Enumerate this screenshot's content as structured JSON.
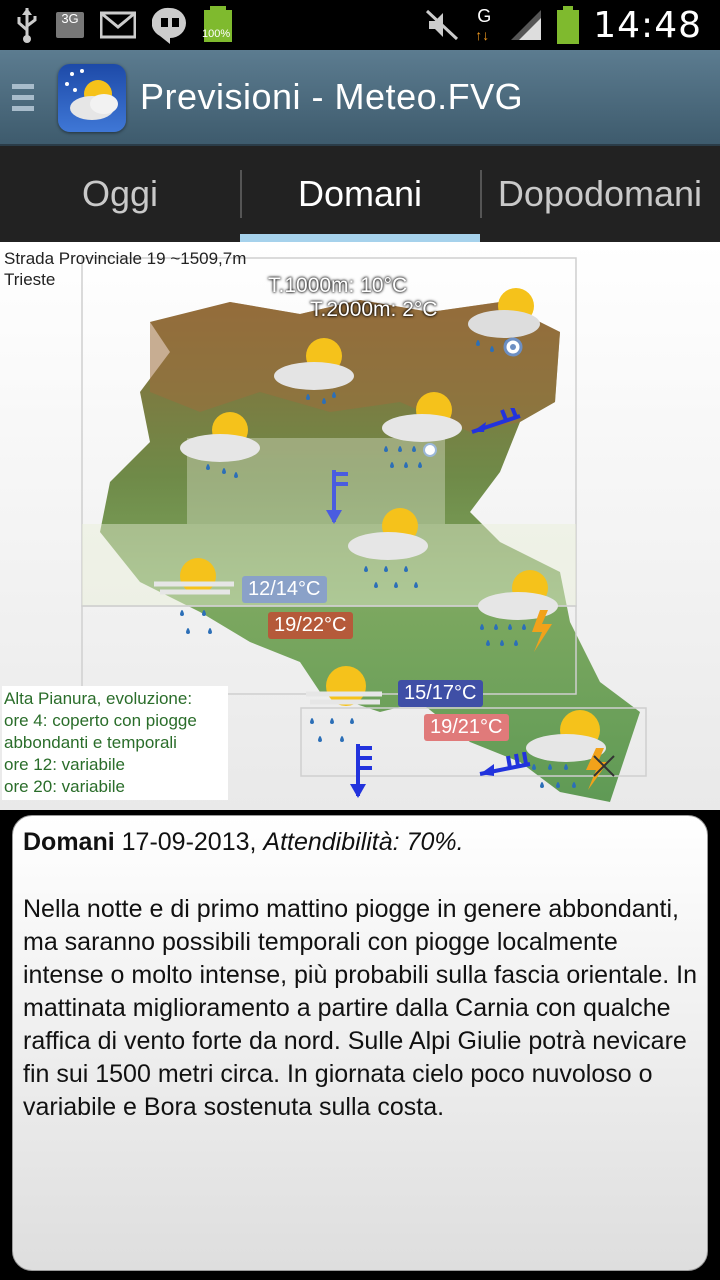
{
  "statusbar": {
    "clock": "14:48",
    "battery_small": "100%",
    "net_3g": "3G",
    "net_g": "G"
  },
  "app": {
    "title": "Previsioni - Meteo.FVG"
  },
  "tabs": [
    {
      "label": "Oggi",
      "active": false
    },
    {
      "label": "Domani",
      "active": true
    },
    {
      "label": "Dopodomani",
      "active": false
    }
  ],
  "map": {
    "location_line1": "Strada Provinciale 19   ~1509,7m",
    "location_line2": "Trieste",
    "t1000": "T.1000m: 10°C",
    "t2000": "T.2000m: 2°C",
    "badges": [
      {
        "text": "12/14°C",
        "color": "#8aa1c8"
      },
      {
        "text": "19/22°C",
        "color": "#b55a3a"
      },
      {
        "text": "15/17°C",
        "color": "#3f4fa6"
      },
      {
        "text": "19/21°C",
        "color": "#e07a7a"
      }
    ],
    "zone": {
      "line1": "Alta Pianura, evoluzione:",
      "line2": "ore 4: coperto con piogge",
      "line3": "abbondanti e temporali",
      "line4": "ore 12: variabile",
      "line5": "ore 20: variabile"
    }
  },
  "forecast": {
    "day": "Domani",
    "date": " 17-09-2013, ",
    "reliability": "Attendibilità: 70%.",
    "text": "Nella notte e di primo mattino piogge in genere abbondanti, ma saranno possibili temporali con piogge localmente intense o molto intense, più probabili sulla fascia orientale. In mattinata miglioramento a partire dalla Carnia con qualche raffica di vento forte da nord. Sulle Alpi Giulie potrà nevicare fin sui 1500 metri circa. In giornata cielo poco nuvoloso o variabile e Bora sostenuta sulla costa."
  },
  "colors": {
    "actionbar": "#4d6b7e",
    "tab_indicator": "#a6d2ec",
    "wind_arrow": "#2233dd"
  }
}
